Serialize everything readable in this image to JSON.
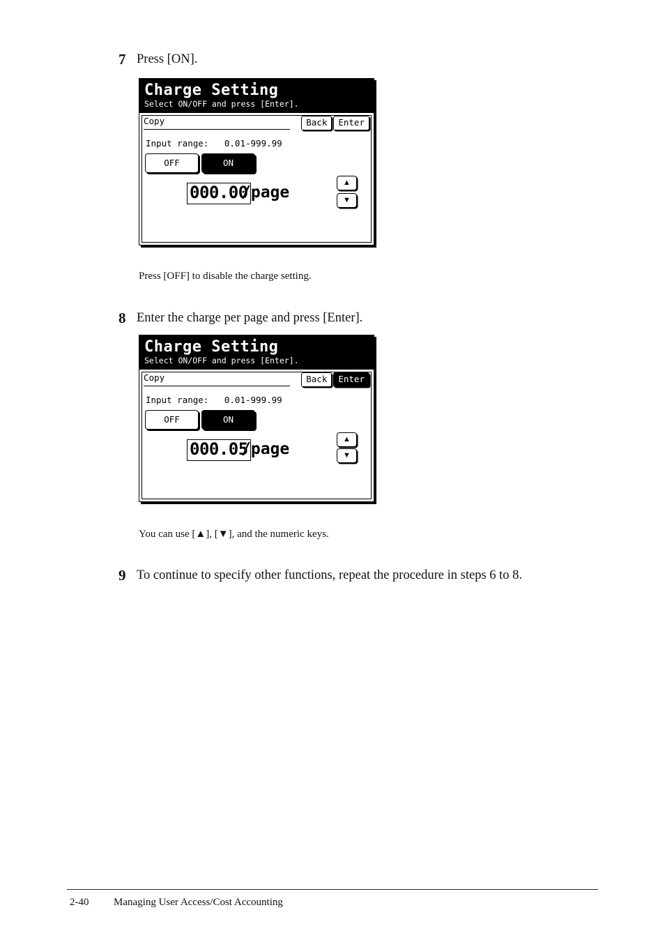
{
  "document": {
    "footer": {
      "page_number": "2-40",
      "section_title": "Managing User Access/Cost Accounting"
    }
  },
  "steps": [
    {
      "number": "7",
      "text": "Press [ON].",
      "note": "Press [OFF] to disable the charge setting."
    },
    {
      "number": "8",
      "text": "Enter the charge per page and press [Enter].",
      "note": "You can use [▲], [▼], and the numeric keys."
    },
    {
      "number": "9",
      "text": "To continue to specify other functions, repeat the procedure in steps 6 to 8.",
      "note": ""
    }
  ],
  "screens": [
    {
      "id": "screen-step7",
      "title": "Charge Setting",
      "subtitle": "Select ON/OFF and press [Enter].",
      "channel_label": "Copy",
      "back_label": "Back",
      "enter_label": "Enter",
      "back_selected": false,
      "enter_selected": false,
      "range_label": "Input range:   0.01-999.99",
      "toggle_off_label": "OFF",
      "toggle_on_label": "ON",
      "toggle_selected": "ON",
      "value": "000.00",
      "unit": "/page",
      "spinner_up": "▲",
      "spinner_down": "▼"
    },
    {
      "id": "screen-step8",
      "title": "Charge Setting",
      "subtitle": "Select ON/OFF and press [Enter].",
      "channel_label": "Copy",
      "back_label": "Back",
      "enter_label": "Enter",
      "back_selected": false,
      "enter_selected": true,
      "range_label": "Input range:   0.01-999.99",
      "toggle_off_label": "OFF",
      "toggle_on_label": "ON",
      "toggle_selected": "ON",
      "value": "000.05",
      "unit": "/page",
      "spinner_up": "▲",
      "spinner_down": "▼"
    }
  ]
}
